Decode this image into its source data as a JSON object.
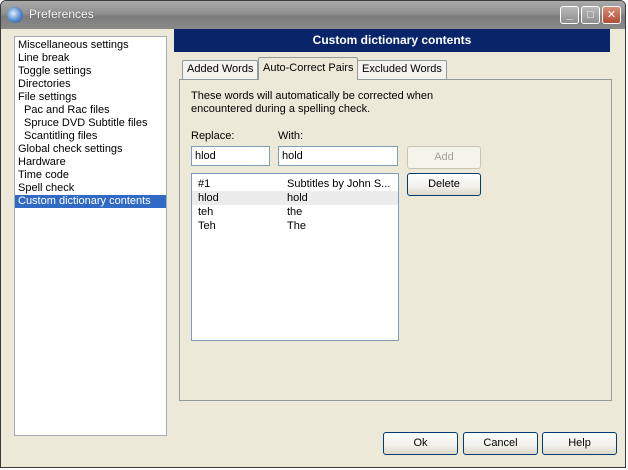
{
  "window": {
    "title": "Preferences"
  },
  "titlebar_buttons": {
    "minimize": "_",
    "maximize": "□",
    "close": "✕"
  },
  "nav": {
    "items": [
      {
        "label": "Miscellaneous settings",
        "sub": false,
        "selected": false
      },
      {
        "label": "Line break",
        "sub": false,
        "selected": false
      },
      {
        "label": "Toggle settings",
        "sub": false,
        "selected": false
      },
      {
        "label": "Directories",
        "sub": false,
        "selected": false
      },
      {
        "label": "File settings",
        "sub": false,
        "selected": false
      },
      {
        "label": "Pac and Rac files",
        "sub": true,
        "selected": false
      },
      {
        "label": "Spruce DVD Subtitle files",
        "sub": true,
        "selected": false
      },
      {
        "label": "Scantitling files",
        "sub": true,
        "selected": false
      },
      {
        "label": "Global check settings",
        "sub": false,
        "selected": false
      },
      {
        "label": "Hardware",
        "sub": false,
        "selected": false
      },
      {
        "label": "Time code",
        "sub": false,
        "selected": false
      },
      {
        "label": "Spell check",
        "sub": false,
        "selected": false
      },
      {
        "label": "Custom dictionary contents",
        "sub": false,
        "selected": true
      }
    ]
  },
  "panel": {
    "title": "Custom dictionary contents"
  },
  "tabs": [
    {
      "label": "Added Words",
      "active": false
    },
    {
      "label": "Auto-Correct Pairs",
      "active": true
    },
    {
      "label": "Excluded Words",
      "active": false
    }
  ],
  "autocorrect": {
    "description": "These words will automatically be corrected when encountered during a spelling check.",
    "replace_label": "Replace:",
    "with_label": "With:",
    "replace_value": "hlod",
    "with_value": "hold",
    "pairs": [
      {
        "from": "#1",
        "to": "Subtitles by John S...",
        "selected": false
      },
      {
        "from": "hlod",
        "to": "hold",
        "selected": true
      },
      {
        "from": "teh",
        "to": "the",
        "selected": false
      },
      {
        "from": "Teh",
        "to": "The",
        "selected": false
      }
    ],
    "add_label": "Add",
    "delete_label": "Delete"
  },
  "footer": {
    "ok_label": "Ok",
    "cancel_label": "Cancel",
    "help_label": "Help"
  },
  "colors": {
    "selection": "#316ac5",
    "panel_header": "#0a246a",
    "dialog_bg": "#ece9d8"
  }
}
